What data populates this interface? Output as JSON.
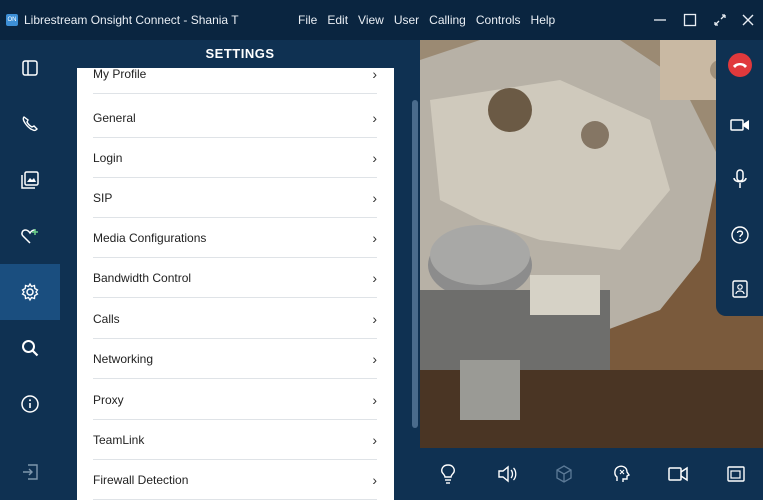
{
  "window": {
    "title": "Librestream Onsight Connect - Shania T",
    "logo_text": "ON"
  },
  "menu": [
    {
      "label": "File",
      "underline": "F"
    },
    {
      "label": "Edit",
      "underline": "E"
    },
    {
      "label": "View",
      "underline": "V"
    },
    {
      "label": "User",
      "underline": "U"
    },
    {
      "label": "Calling",
      "underline": "C"
    },
    {
      "label": "Controls",
      "underline": "o"
    },
    {
      "label": "Help",
      "underline": "H"
    }
  ],
  "leftnav": {
    "items": [
      {
        "icon": "panel-toggle-icon"
      },
      {
        "icon": "phone-icon"
      },
      {
        "icon": "gallery-icon"
      },
      {
        "icon": "favorites-heart-icon"
      },
      {
        "icon": "settings-gear-icon",
        "active": true
      },
      {
        "icon": "search-icon"
      },
      {
        "icon": "info-icon"
      },
      {
        "icon": "sign-out-icon"
      }
    ]
  },
  "settings": {
    "title": "SETTINGS",
    "items": [
      {
        "label": "My Profile"
      },
      {
        "label": "General"
      },
      {
        "label": "Login"
      },
      {
        "label": "SIP"
      },
      {
        "label": "Media Configurations"
      },
      {
        "label": "Bandwidth Control"
      },
      {
        "label": "Calls"
      },
      {
        "label": "Networking"
      },
      {
        "label": "Proxy"
      },
      {
        "label": "TeamLink"
      },
      {
        "label": "Firewall Detection"
      }
    ],
    "chevron": "›"
  },
  "callbar": {
    "items": [
      "end-call-icon",
      "video-camera-icon",
      "microphone-icon",
      "help-icon",
      "contact-card-icon"
    ]
  },
  "bottombar": {
    "items": [
      "lightbulb-icon",
      "speaker-icon",
      "3d-box-icon",
      "head-tracking-icon",
      "video-camera-icon",
      "picture-in-picture-icon"
    ]
  },
  "colors": {
    "titlebar": "#0a2540",
    "panel": "#0f3152",
    "active_nav": "#1a4e7f",
    "end_call": "#e0393c"
  }
}
